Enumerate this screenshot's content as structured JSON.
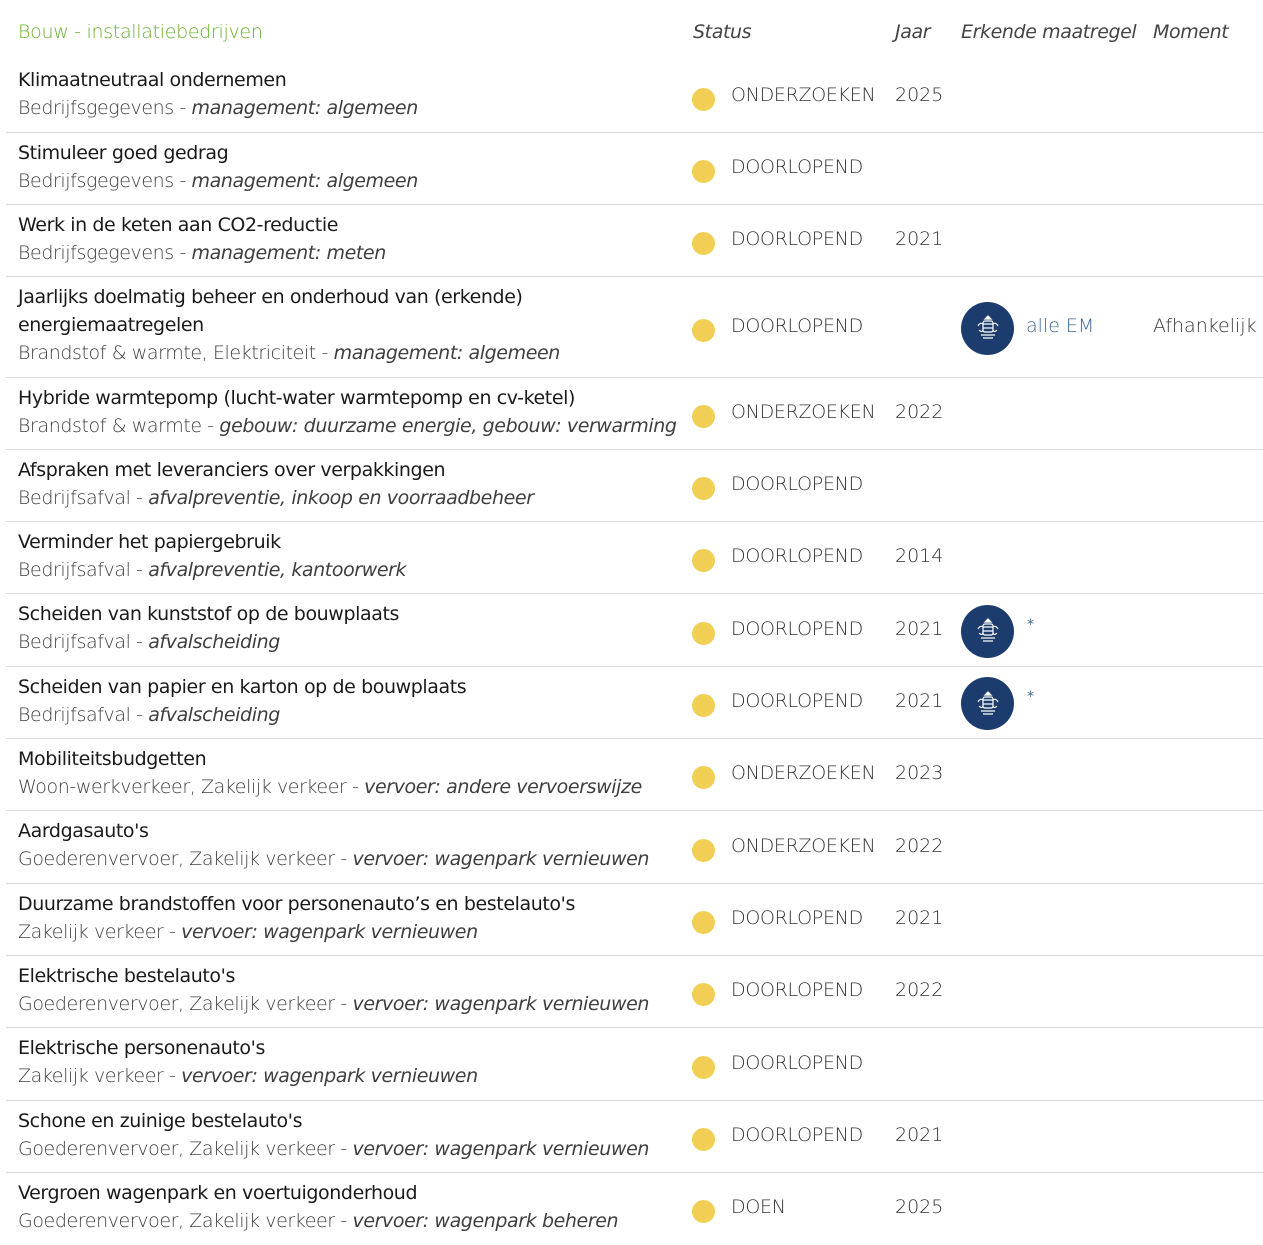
{
  "header": {
    "title": "Bouw - installatiebedrijven",
    "col_status": "Status",
    "col_year": "Jaar",
    "col_em": "Erkende maatregel",
    "col_moment": "Moment"
  },
  "colors": {
    "status_dot": "#f1cf55",
    "badge": "#1d3c6e",
    "header_title": "#6aaf2f",
    "link": "#3e6a96"
  },
  "rows": [
    {
      "title": "Klimaatneutraal ondernemen",
      "category": "Bedrijfsgegevens - ",
      "tags": "management: algemeen",
      "status": "ONDERZOEKEN",
      "year": "2025"
    },
    {
      "title": "Stimuleer goed gedrag",
      "category": "Bedrijfsgegevens - ",
      "tags": "management: algemeen",
      "status": "DOORLOPEND",
      "year": ""
    },
    {
      "title": "Werk in de keten aan CO2-reductie",
      "category": "Bedrijfsgegevens - ",
      "tags": "management: meten",
      "status": "DOORLOPEND",
      "year": "2021"
    },
    {
      "title": "Jaarlijks doelmatig beheer en onderhoud van (erkende)",
      "title2": "energiemaatregelen",
      "category": "Brandstof & warmte, Elektriciteit - ",
      "tags": "management: algemeen",
      "status": "DOORLOPEND",
      "year": "",
      "em_icon": "rijksoverheid-crest-icon",
      "em_label": "alle EM",
      "moment": "Afhankelijk"
    },
    {
      "title": "Hybride warmtepomp (lucht-water warmtepomp en cv-ketel)",
      "category": "Brandstof & warmte - ",
      "tags": "gebouw: duurzame energie, gebouw: verwarming",
      "status": "ONDERZOEKEN",
      "year": "2022"
    },
    {
      "title": "Afspraken met leveranciers over verpakkingen",
      "category": "Bedrijfsafval - ",
      "tags": "afvalpreventie, inkoop en voorraadbeheer",
      "status": "DOORLOPEND",
      "year": ""
    },
    {
      "title": "Verminder het papiergebruik",
      "category": "Bedrijfsafval - ",
      "tags": "afvalpreventie, kantoorwerk",
      "status": "DOORLOPEND",
      "year": "2014"
    },
    {
      "title": "Scheiden van kunststof op de bouwplaats",
      "category": "Bedrijfsafval - ",
      "tags": "afvalscheiding",
      "status": "DOORLOPEND",
      "year": "2021",
      "em_icon": "rijksoverheid-crest-icon",
      "em_label": "*"
    },
    {
      "title": "Scheiden van papier en karton op de bouwplaats",
      "category": "Bedrijfsafval - ",
      "tags": "afvalscheiding",
      "status": "DOORLOPEND",
      "year": "2021",
      "em_icon": "rijksoverheid-crest-icon",
      "em_label": "*"
    },
    {
      "title": "Mobiliteitsbudgetten",
      "category": "Woon-werkverkeer, Zakelijk verkeer - ",
      "tags": "vervoer: andere vervoerswijze",
      "status": "ONDERZOEKEN",
      "year": "2023"
    },
    {
      "title": "Aardgasauto's",
      "category": "Goederenvervoer, Zakelijk verkeer - ",
      "tags": "vervoer: wagenpark vernieuwen",
      "status": "ONDERZOEKEN",
      "year": "2022"
    },
    {
      "title": "Duurzame brandstoffen voor personenauto’s en bestelauto's",
      "category": "Zakelijk verkeer - ",
      "tags": "vervoer: wagenpark vernieuwen",
      "status": "DOORLOPEND",
      "year": "2021"
    },
    {
      "title": "Elektrische bestelauto's",
      "category": "Goederenvervoer, Zakelijk verkeer - ",
      "tags": "vervoer: wagenpark vernieuwen",
      "status": "DOORLOPEND",
      "year": "2022"
    },
    {
      "title": "Elektrische personenauto's",
      "category": "Zakelijk verkeer - ",
      "tags": "vervoer: wagenpark vernieuwen",
      "status": "DOORLOPEND",
      "year": ""
    },
    {
      "title": "Schone en zuinige bestelauto's",
      "category": "Goederenvervoer, Zakelijk verkeer - ",
      "tags": "vervoer: wagenpark vernieuwen",
      "status": "DOORLOPEND",
      "year": "2021"
    },
    {
      "title": "Vergroen wagenpark en voertuigonderhoud",
      "category": "Goederenvervoer, Zakelijk verkeer - ",
      "tags": "vervoer: wagenpark beheren",
      "status": "DOEN",
      "year": "2025"
    }
  ]
}
